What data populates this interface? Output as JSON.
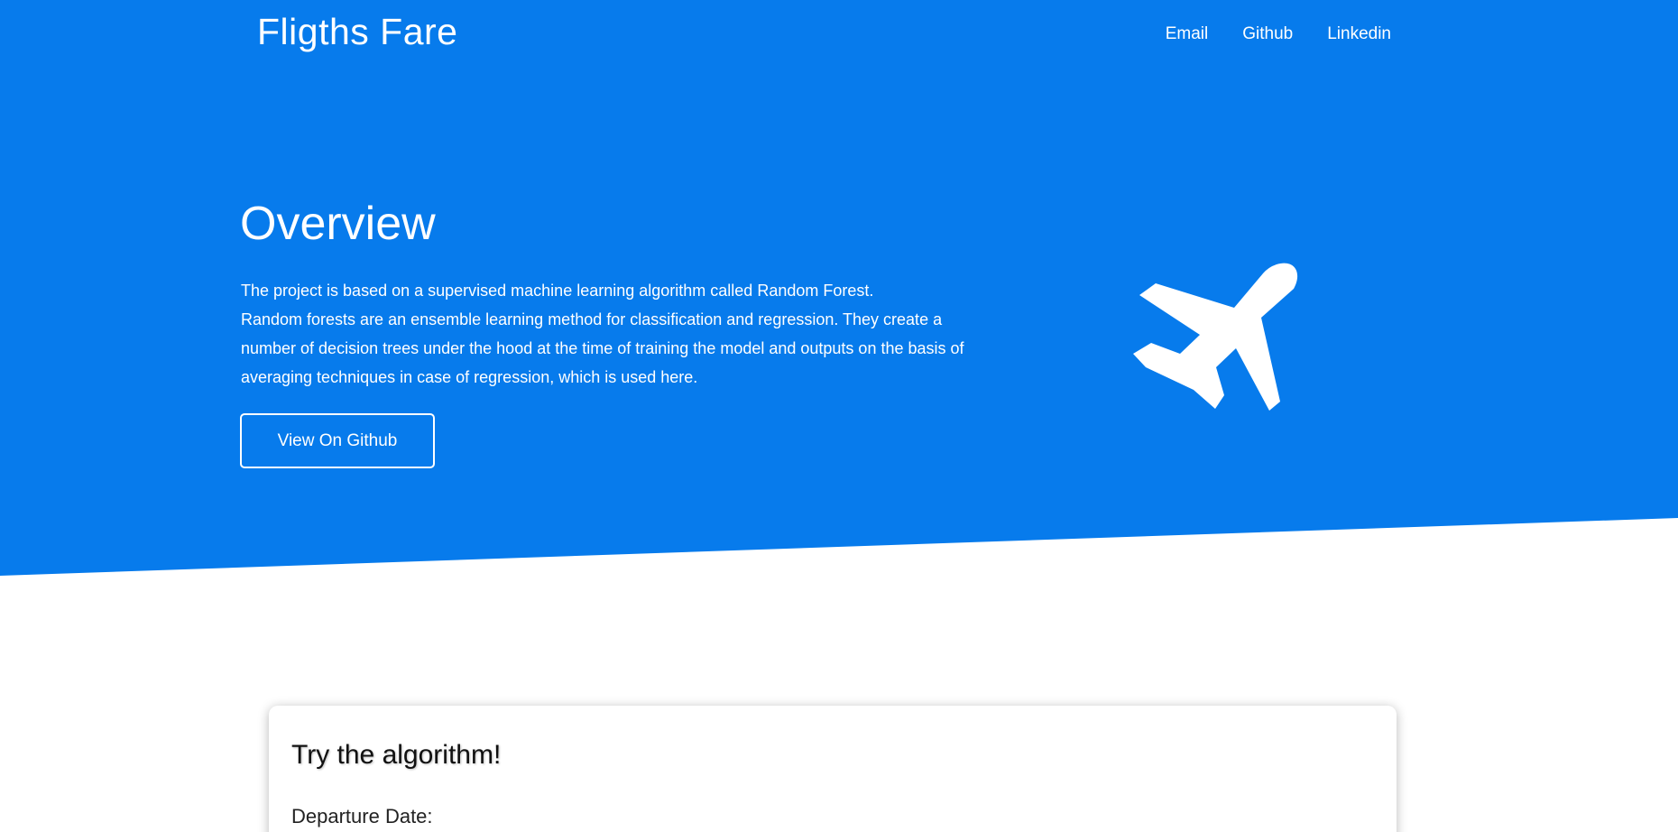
{
  "colors": {
    "primary_blue": "#077bec",
    "white": "#ffffff"
  },
  "navbar": {
    "brand": "Fligths Fare",
    "links": [
      {
        "label": "Email"
      },
      {
        "label": "Github"
      },
      {
        "label": "Linkedin"
      }
    ]
  },
  "hero": {
    "title": "Overview",
    "paragraph_1": "The project is based on a supervised machine learning algorithm called Random Forest.",
    "paragraph_2": "Random forests are an ensemble learning method for classification and regression. They create a number of decision trees under the hood at the time of training the model and outputs on the basis of averaging techniques in case of regression, which is used here.",
    "button_label": "View On Github",
    "icon": "airplane-icon"
  },
  "form_card": {
    "title": "Try the algorithm!",
    "departure_label": "Departure Date:"
  }
}
